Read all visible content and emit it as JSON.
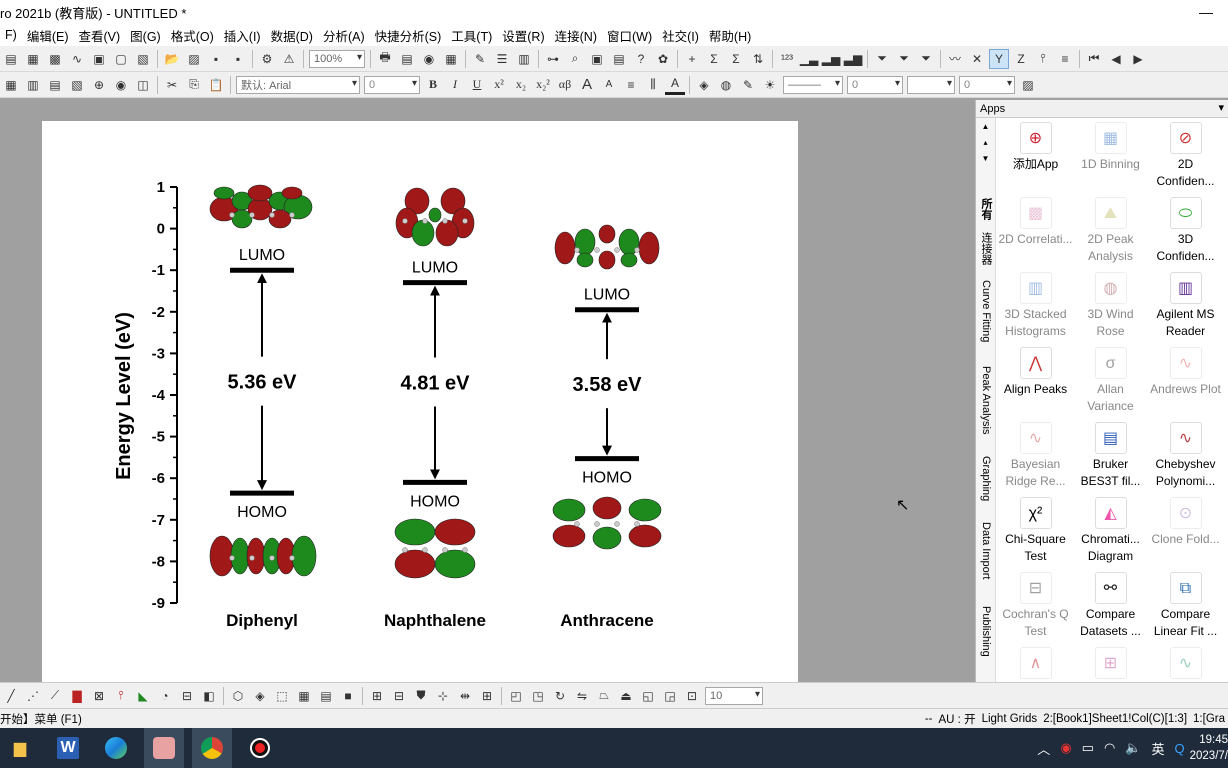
{
  "window": {
    "title": "ro 2021b (教育版) - UNTITLED *",
    "minimize": "—",
    "maximize": "☐"
  },
  "menu": [
    "F)",
    "编辑(E)",
    "查看(V)",
    "图(G)",
    "格式(O)",
    "插入(I)",
    "数据(D)",
    "分析(A)",
    "快捷分析(S)",
    "工具(T)",
    "设置(R)",
    "连接(N)",
    "窗口(W)",
    "社交(I)",
    "帮助(H)"
  ],
  "toolbar1": {
    "zoom": "100%"
  },
  "toolbar2": {
    "font": "默认: Arial",
    "font_size": "0",
    "bold": "B",
    "italic": "I",
    "underline": "U",
    "superscript": "x²",
    "subscript": "x₂",
    "supsub": "x₂²",
    "greek": "αβ",
    "bigger": "A",
    "smaller": "A",
    "line_width": "0",
    "line_width2": "0"
  },
  "row_label": "1",
  "chart_data": {
    "type": "diagram",
    "ylabel": "Energy Level (eV)",
    "ylim": [
      -9,
      1
    ],
    "yticks": [
      "1",
      "0",
      "-1",
      "-2",
      "-3",
      "-4",
      "-5",
      "-6",
      "-7",
      "-8",
      "-9"
    ],
    "molecules": [
      {
        "name": "Diphenyl",
        "lumo": -1.0,
        "homo": -6.36,
        "gap_label": "5.36 eV",
        "lumo_label": "LUMO",
        "homo_label": "HOMO"
      },
      {
        "name": "Naphthalene",
        "lumo": -1.3,
        "homo": -6.1,
        "gap_label": "4.81 eV",
        "lumo_label": "LUMO",
        "homo_label": "HOMO"
      },
      {
        "name": "Anthracene",
        "lumo": -1.95,
        "homo": -5.53,
        "gap_label": "3.58 eV",
        "lumo_label": "LUMO",
        "homo_label": "HOMO"
      }
    ],
    "colors": {
      "lobe_red": "#a01818",
      "lobe_green": "#1e8a1e"
    }
  },
  "apps": {
    "header": "Apps",
    "tabs": [
      "所有",
      "连接器",
      "Curve Fitting",
      "Peak Analysis",
      "Graphing",
      "Data Import",
      "Publishing"
    ],
    "items": [
      {
        "label": "添加App",
        "icon": "add-app-icon",
        "dim": false
      },
      {
        "label": "1D Binning",
        "icon": "binning-icon",
        "dim": true
      },
      {
        "label": "2D Confiden...",
        "icon": "confidence-2d-icon",
        "dim": false
      },
      {
        "label": "2D Correlati...",
        "icon": "correlation-icon",
        "dim": true
      },
      {
        "label": "2D Peak Analysis",
        "icon": "peak-2d-icon",
        "dim": true
      },
      {
        "label": "3D Confiden...",
        "icon": "confidence-3d-icon",
        "dim": false
      },
      {
        "label": "3D Stacked Histograms",
        "icon": "stacked-hist-icon",
        "dim": true
      },
      {
        "label": "3D Wind Rose",
        "icon": "wind-rose-icon",
        "dim": true
      },
      {
        "label": "Agilent MS Reader",
        "icon": "agilent-icon",
        "dim": false
      },
      {
        "label": "Align Peaks",
        "icon": "align-peaks-icon",
        "dim": false
      },
      {
        "label": "Allan Variance",
        "icon": "allan-icon",
        "dim": true
      },
      {
        "label": "Andrews Plot",
        "icon": "andrews-icon",
        "dim": true
      },
      {
        "label": "Bayesian Ridge Re...",
        "icon": "bayesian-icon",
        "dim": true
      },
      {
        "label": "Bruker BES3T fil...",
        "icon": "bruker-icon",
        "dim": false
      },
      {
        "label": "Chebyshev Polynomi...",
        "icon": "chebyshev-icon",
        "dim": false
      },
      {
        "label": "Chi-Square Test",
        "icon": "chi-square-icon",
        "dim": false
      },
      {
        "label": "Chromati... Diagram",
        "icon": "chromaticity-icon",
        "dim": false
      },
      {
        "label": "Clone Fold...",
        "icon": "clone-icon",
        "dim": true
      },
      {
        "label": "Cochran's Q Test",
        "icon": "cochran-icon",
        "dim": true
      },
      {
        "label": "Compare Datasets ...",
        "icon": "compare-datasets-icon",
        "dim": false
      },
      {
        "label": "Compare Linear Fit ...",
        "icon": "compare-fit-icon",
        "dim": false
      },
      {
        "label": "",
        "icon": "spectrum-icon",
        "dim": true
      },
      {
        "label": "",
        "icon": "flow-icon",
        "dim": true
      },
      {
        "label": "",
        "icon": "curve-icon",
        "dim": true
      }
    ]
  },
  "bottom_toolbar": {
    "size": "10"
  },
  "status": {
    "left": "开始】菜单 (F1)",
    "dashes": "--",
    "au": "AU : 开",
    "grids": "Light Grids",
    "book": "2:[Book1]Sheet1!Col(C)[1:3]",
    "graph": "1:[Gra"
  },
  "taskbar": {
    "ime": "英",
    "time": "19:45",
    "date": "2023/7/"
  }
}
